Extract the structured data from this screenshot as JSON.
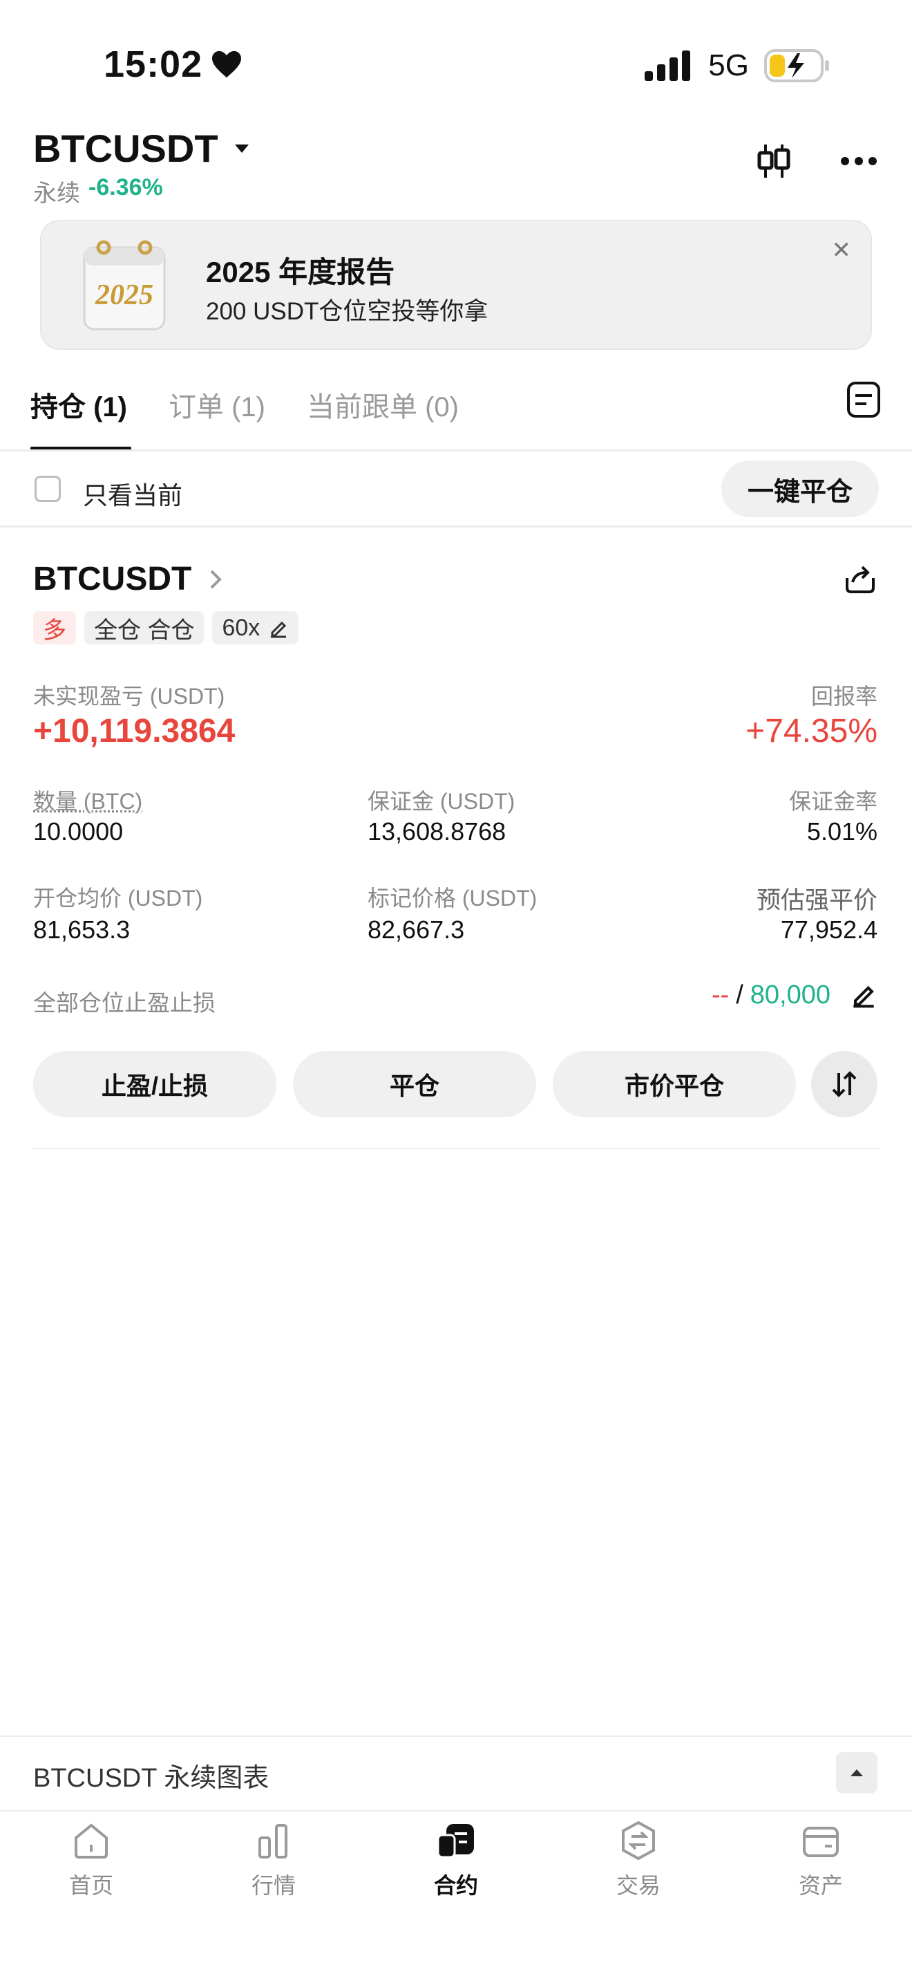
{
  "status_bar": {
    "time": "15:02",
    "network": "5G"
  },
  "header": {
    "pair": "BTCUSDT",
    "contract_type": "永续",
    "change": "-6.36%"
  },
  "banner": {
    "title": "2025 年度报告",
    "subtitle": "200 USDT仓位空投等你拿",
    "badge": "2025"
  },
  "tabs": [
    {
      "label": "持仓 (1)",
      "active": true
    },
    {
      "label": "订单 (1)",
      "active": false
    },
    {
      "label": "当前跟单 (0)",
      "active": false
    }
  ],
  "filter": {
    "current_only_label": "只看当前",
    "close_all_label": "一键平仓"
  },
  "position": {
    "symbol": "BTCUSDT",
    "side": "多",
    "margin_mode": "全仓 合仓",
    "leverage": "60x",
    "unrealized_pnl_label": "未实现盈亏 (USDT)",
    "unrealized_pnl": "+10,119.3864",
    "roe_label": "回报率",
    "roe": "+74.35%",
    "qty_label": "数量 (BTC)",
    "qty": "10.0000",
    "margin_label": "保证金 (USDT)",
    "margin": "13,608.8768",
    "margin_ratio_label": "保证金率",
    "margin_ratio": "5.01%",
    "entry_label": "开仓均价 (USDT)",
    "entry": "81,653.3",
    "mark_label": "标记价格 (USDT)",
    "mark": "82,667.3",
    "liq_label": "预估强平价",
    "liq": "77,952.4",
    "tpsl_label": "全部仓位止盈止损",
    "tp": "--",
    "slash": "/",
    "sl": "80,000"
  },
  "actions": {
    "tpsl": "止盈/止损",
    "close": "平仓",
    "market_close": "市价平仓"
  },
  "chart_bar": {
    "label": "BTCUSDT 永续图表"
  },
  "nav": [
    {
      "label": "首页",
      "icon": "home-icon",
      "active": false
    },
    {
      "label": "行情",
      "icon": "market-icon",
      "active": false
    },
    {
      "label": "合约",
      "icon": "futures-icon",
      "active": true
    },
    {
      "label": "交易",
      "icon": "trade-icon",
      "active": false
    },
    {
      "label": "资产",
      "icon": "wallet-icon",
      "active": false
    }
  ],
  "colors": {
    "up": "#1fb28a",
    "down": "#e8453c",
    "text": "#111111",
    "muted": "#8a8a8a"
  }
}
